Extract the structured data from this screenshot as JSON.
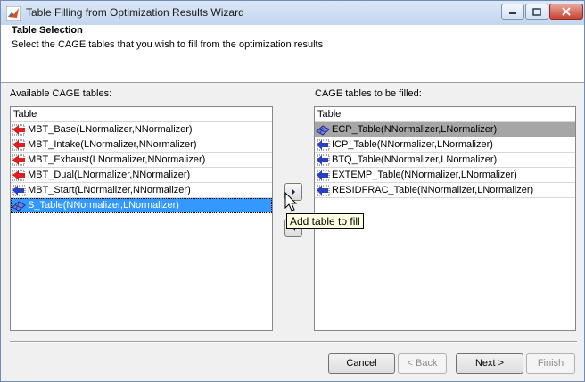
{
  "window": {
    "title": "Table Filling from Optimization Results Wizard"
  },
  "header": {
    "title": "Table Selection",
    "subtitle": "Select the CAGE tables that you wish to fill from the optimization results"
  },
  "available": {
    "label": "Available CAGE tables:",
    "column_header": "Table",
    "items": [
      {
        "label": "MBT_Base(LNormalizer,NNormalizer)",
        "icon": "red-arrow-table-icon"
      },
      {
        "label": "MBT_Intake(LNormalizer,NNormalizer)",
        "icon": "red-arrow-table-icon"
      },
      {
        "label": "MBT_Exhaust(LNormalizer,NNormalizer)",
        "icon": "red-arrow-table-icon"
      },
      {
        "label": "MBT_Dual(LNormalizer,NNormalizer)",
        "icon": "red-arrow-table-icon"
      },
      {
        "label": "MBT_Start(LNormalizer,NNormalizer)",
        "icon": "blue-arrow-table-icon"
      },
      {
        "label": "S_Table(NNormalizer,LNormalizer)",
        "icon": "blue-table-icon",
        "selected": true
      }
    ]
  },
  "to_fill": {
    "label": "CAGE tables to be filled:",
    "column_header": "Table",
    "items": [
      {
        "label": "ECP_Table(NNormalizer,LNormalizer)",
        "icon": "blue-table-icon",
        "selected": true
      },
      {
        "label": "ICP_Table(NNormalizer,LNormalizer)",
        "icon": "blue-arrow-table-icon"
      },
      {
        "label": "BTQ_Table(NNormalizer,LNormalizer)",
        "icon": "blue-arrow-table-icon"
      },
      {
        "label": "EXTEMP_Table(NNormalizer,LNormalizer)",
        "icon": "blue-arrow-table-icon"
      },
      {
        "label": "RESIDFRAC_Table(NNormalizer,LNormalizer)",
        "icon": "blue-arrow-table-icon"
      }
    ]
  },
  "transfer": {
    "add_icon": "right-arrow-icon",
    "remove_icon": "left-arrow-icon",
    "tooltip": "Add table to fill"
  },
  "footer": {
    "cancel": "Cancel",
    "back": "< Back",
    "next": "Next >",
    "finish": "Finish"
  },
  "colors": {
    "selection": "#3399ff",
    "selection_inactive": "#a6a6a6",
    "red_arrow": "#e02020",
    "blue_arrow": "#2b3fc4"
  }
}
